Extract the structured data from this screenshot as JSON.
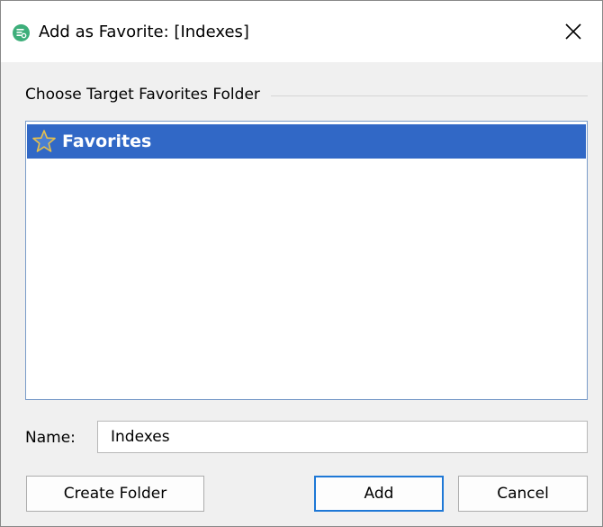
{
  "window": {
    "title": "Add as Favorite: [Indexes]",
    "app_icon": "app-logo-icon",
    "close_icon": "close-icon"
  },
  "group": {
    "label": "Choose Target Favorites Folder"
  },
  "tree": {
    "items": [
      {
        "label": "Favorites",
        "icon": "star-icon",
        "selected": true
      }
    ]
  },
  "name_field": {
    "label": "Name:",
    "value": "Indexes"
  },
  "buttons": {
    "create_folder": "Create Folder",
    "add": "Add",
    "cancel": "Cancel"
  },
  "colors": {
    "selection": "#3168c6",
    "default_button_border": "#1e78d6",
    "app_icon": "#3dae7a"
  }
}
